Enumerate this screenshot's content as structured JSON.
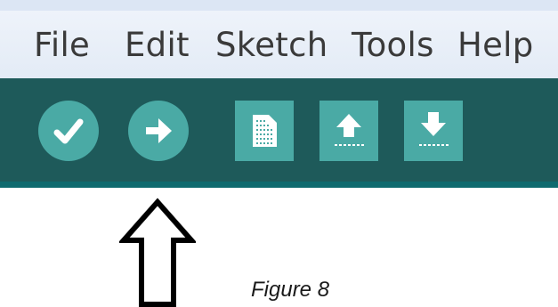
{
  "menubar": {
    "items": [
      {
        "label": "File"
      },
      {
        "label": "Edit"
      },
      {
        "label": "Sketch"
      },
      {
        "label": "Tools"
      },
      {
        "label": "Help"
      }
    ]
  },
  "toolbar": {
    "buttons": [
      {
        "icon": "checkmark-icon"
      },
      {
        "icon": "arrow-right-icon"
      },
      {
        "icon": "document-icon"
      },
      {
        "icon": "arrow-up-icon"
      },
      {
        "icon": "arrow-down-icon"
      }
    ]
  },
  "colors": {
    "toolbar_bg": "#1e5a5a",
    "button": "#4aaaa5",
    "menubar_bg": "#e6edf7"
  },
  "caption": {
    "text": "Figure 8"
  }
}
